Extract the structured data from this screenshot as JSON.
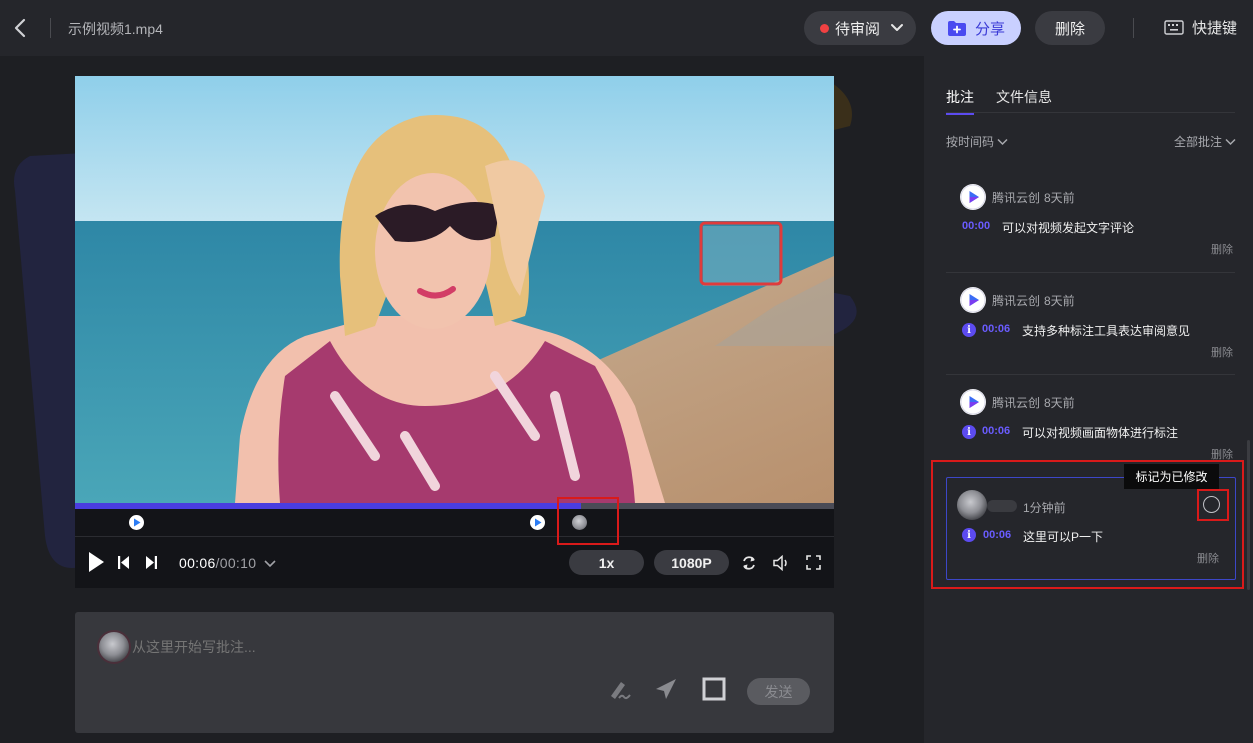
{
  "header": {
    "filename": "示例视频1.mp4",
    "status_label": "待审阅",
    "share_label": "分享",
    "delete_label": "删除",
    "shortcut_label": "快捷键"
  },
  "player": {
    "current_time": "00:06",
    "separator": "/",
    "total_time": "00:10",
    "speed": "1x",
    "quality": "1080P",
    "progress": 0.667
  },
  "composer": {
    "placeholder": "从这里开始写批注...",
    "send_label": "发送"
  },
  "panel": {
    "tabs": [
      "批注",
      "文件信息"
    ],
    "sort_label": "按时间码",
    "filter_label": "全部批注",
    "tooltip": "标记为已修改",
    "comments": [
      {
        "author": "腾讯云创",
        "time": "8天前",
        "timecode": "00:00",
        "text": "可以对视频发起文字评论",
        "delete": "删除"
      },
      {
        "author": "腾讯云创",
        "time": "8天前",
        "timecode": "00:06",
        "text": "支持多种标注工具表达审阅意见",
        "delete": "删除"
      },
      {
        "author": "腾讯云创",
        "time": "8天前",
        "timecode": "00:06",
        "text": "可以对视频画面物体进行标注",
        "delete": "删除"
      },
      {
        "author": "",
        "time": "1分钟前",
        "timecode": "00:06",
        "text": "这里可以P一下",
        "delete": "删除"
      }
    ]
  },
  "colors": {
    "accent": "#5c4bf0",
    "status_red": "#f04142",
    "highlight_red": "#d91a1a",
    "share_bg": "#c9d0ff"
  }
}
